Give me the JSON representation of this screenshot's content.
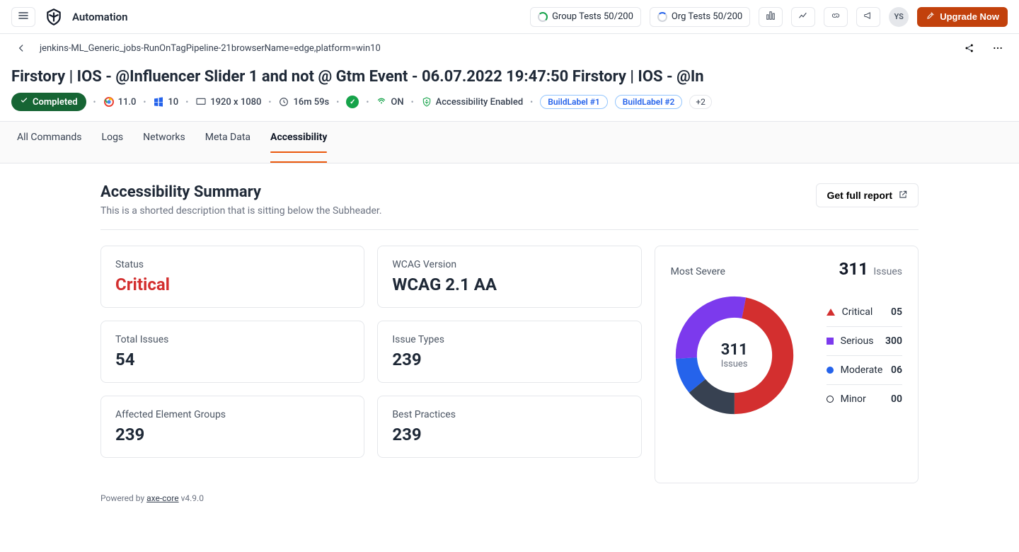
{
  "header": {
    "product": "Automation",
    "group_tests": "Group Tests 50/200",
    "org_tests": "Org Tests 50/200",
    "avatar": "YS",
    "upgrade_label": "Upgrade Now"
  },
  "breadcrumb": {
    "path": "jenkins-ML_Generic_jobs-RunOnTagPipeline-21browserName=edge,platform=win10"
  },
  "pagetitle": "Firstory | IOS - @Influencer Slider 1 and not @ Gtm Event - 06.07.2022 19:47:50 Firstory | IOS - @In",
  "meta": {
    "status": "Completed",
    "browser_version": "11.0",
    "os_version": "10",
    "resolution": "1920 x 1080",
    "duration": "16m 59s",
    "local_state": "ON",
    "accessibility": "Accessibility Enabled",
    "labels": [
      "BuildLabel #1",
      "BuildLabel #2"
    ],
    "extra_count": "+2"
  },
  "tabs": [
    "All Commands",
    "Logs",
    "Networks",
    "Meta Data",
    "Accessibility"
  ],
  "active_tab_index": 4,
  "summary": {
    "heading": "Accessibility Summary",
    "subtitle": "This is a shorted description that is sitting below the Subheader.",
    "report_btn": "Get full report",
    "cards": {
      "status_label": "Status",
      "status_value": "Critical",
      "wcag_label": "WCAG Version",
      "wcag_value": "WCAG 2.1 AA",
      "total_label": "Total Issues",
      "total_value": "54",
      "types_label": "Issue Types",
      "types_value": "239",
      "groups_label": "Affected Element Groups",
      "groups_value": "239",
      "bp_label": "Best Practices",
      "bp_value": "239"
    },
    "donut": {
      "title": "Most Severe",
      "total_num": "311",
      "total_label": "Issues",
      "center_num": "311",
      "center_label": "Issues",
      "legend": [
        {
          "name": "Critical",
          "value": "05"
        },
        {
          "name": "Serious",
          "value": "300"
        },
        {
          "name": "Moderate",
          "value": "06"
        },
        {
          "name": "Minor",
          "value": "00"
        }
      ]
    },
    "powered_prefix": "Powered by ",
    "powered_link": "axe-core",
    "powered_version": " v4.9.0"
  },
  "chart_data": {
    "type": "pie",
    "title": "Most Severe",
    "categories": [
      "Critical",
      "Serious",
      "Moderate",
      "Minor"
    ],
    "values": [
      5,
      300,
      6,
      0
    ],
    "total": 311,
    "colors": [
      "#d32f2f",
      "#7c3aed",
      "#2563eb",
      "#374151"
    ]
  }
}
